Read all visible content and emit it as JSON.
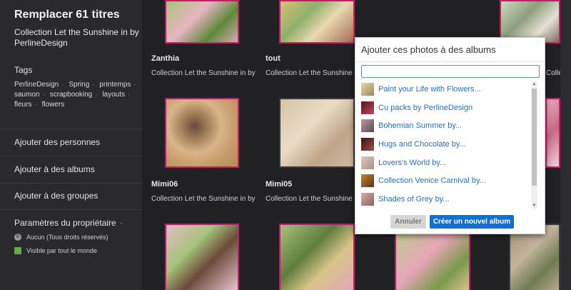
{
  "sidebar": {
    "title": "Remplacer 61 titres",
    "subtitle": "Collection Let the Sunshine in by PerlineDesign",
    "tags_heading": "Tags",
    "tags": [
      "PerlineDesign",
      "Spring",
      "printemps",
      "saumon",
      "scrapbooking",
      "layouts",
      "fleurs",
      "flowers"
    ],
    "add_people": "Ajouter des personnes",
    "add_albums": "Ajouter à des albums",
    "add_groups": "Ajouter à des groupes",
    "owner_settings": "Paramètres du propriétaire",
    "owner_dot": "·",
    "copyright": "Aucun (Tous droits réservés)",
    "copyright_icon": "copyright-icon",
    "visibility": "Visible par tout le monde",
    "visibility_icon": "visibility-icon"
  },
  "photos": [
    {
      "title": "Zanthia",
      "desc": "Collection Let the Sunshine in by"
    },
    {
      "title": "tout",
      "desc": "Collection Let the Sunshine in by"
    },
    {
      "title": "",
      "desc": "Collection Let the Sunshine in by"
    },
    {
      "title": "Mimi06",
      "desc": "Collection Let the Sunshine in by"
    },
    {
      "title": "Mimi05",
      "desc": "Collection Let the Sunshine in by"
    }
  ],
  "dialog": {
    "title": "Ajouter ces photos à des albums",
    "search_value": "",
    "albums": [
      {
        "label": "Paint your Life with Flowers...",
        "color": "#c9b38a"
      },
      {
        "label": "Cu packs by PerlineDesign",
        "color": "#7a2030"
      },
      {
        "label": "Bohemian Summer by...",
        "color": "#8a6a70"
      },
      {
        "label": "Hugs and Chocolate by...",
        "color": "#6a2a2a"
      },
      {
        "label": "Lovers's World by...",
        "color": "#c8a8a0"
      },
      {
        "label": "Collection Venice Carnival by...",
        "color": "#9a6030"
      },
      {
        "label": "Shades of Grey by...",
        "color": "#b89088"
      }
    ],
    "cancel_label": "Annuler",
    "create_label": "Créer un nouvel album"
  },
  "colors": {
    "accent": "#1170d1",
    "thumb_border": "#c71a6b",
    "link": "#2a6ebb"
  }
}
